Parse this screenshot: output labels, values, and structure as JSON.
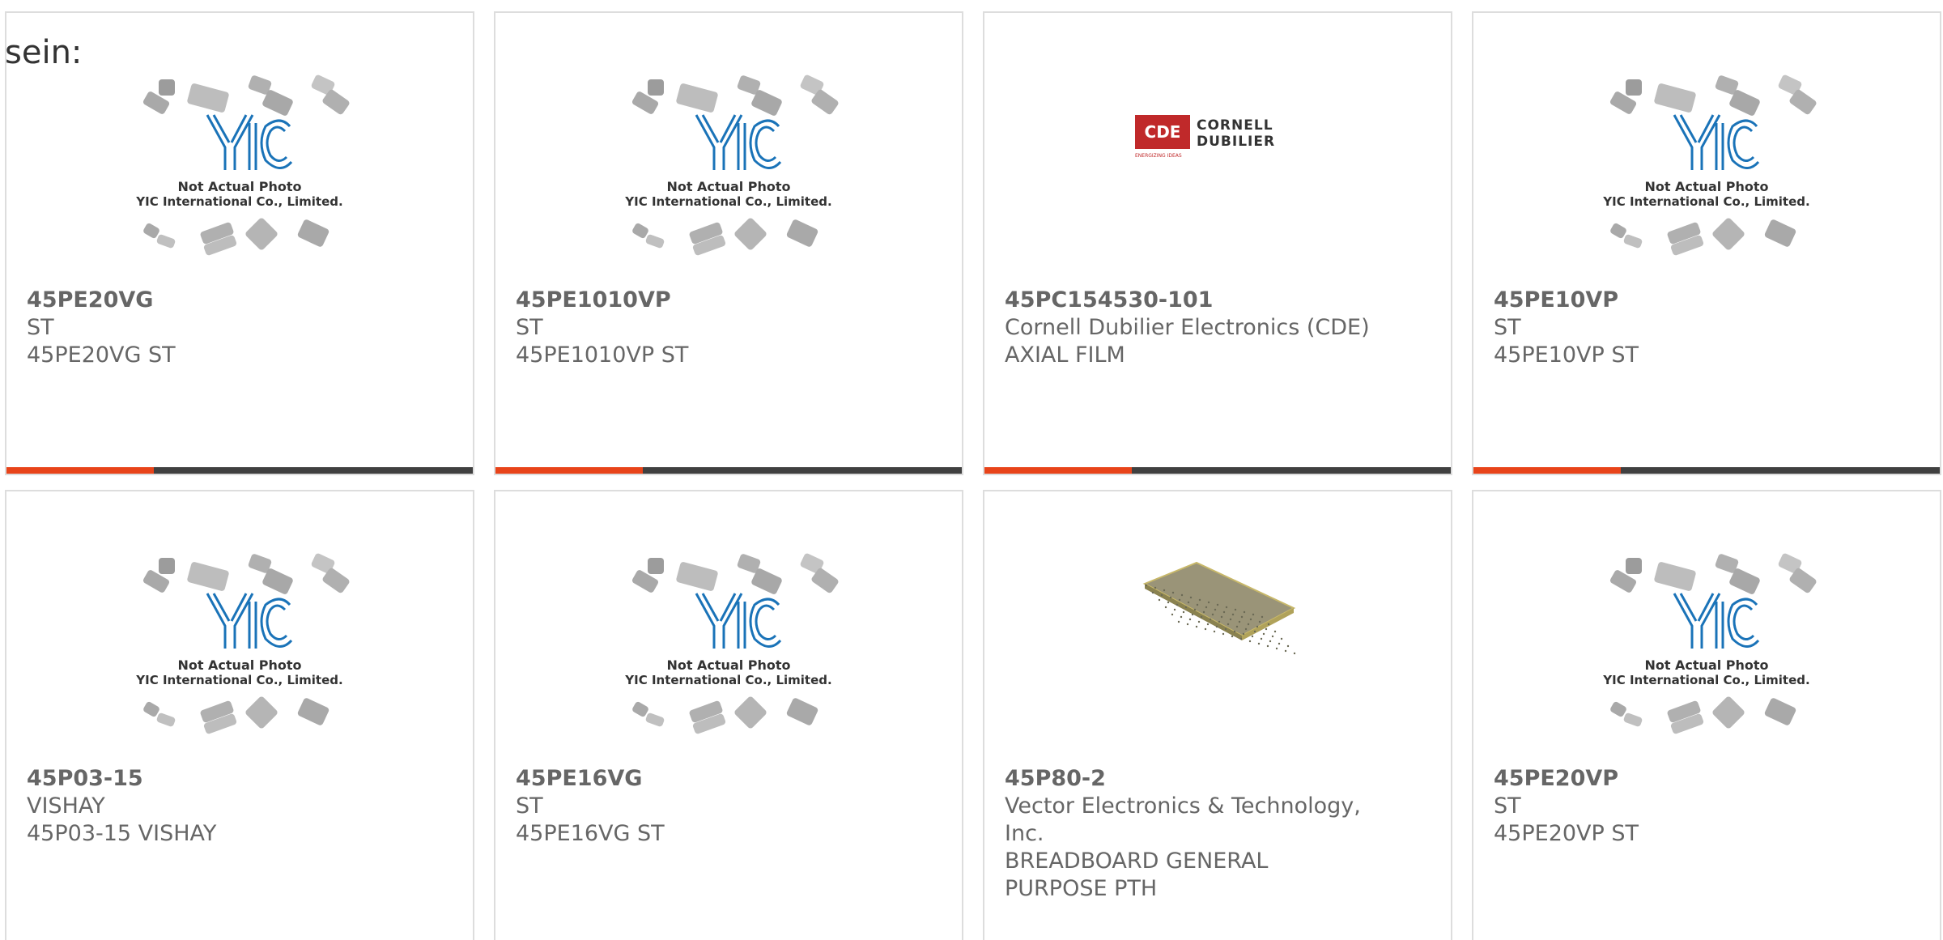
{
  "overlay": {
    "text": "sein:"
  },
  "placeholder_image": {
    "line1": "Not Actual Photo",
    "line2": "YIC International Co., Limited.",
    "logo_text": "YIC"
  },
  "cde_logo": {
    "badge": "CDE",
    "line1": "CORNELL",
    "line2": "DUBILIER",
    "tagline": "ENERGIZING IDEAS"
  },
  "colors": {
    "accent": "#e8441a",
    "bar": "#404040",
    "text": "#666666",
    "border": "#dddddd",
    "logo_blue": "#1a73b8"
  },
  "products": [
    {
      "title": "45PE20VG",
      "lines": [
        "ST",
        "45PE20VG ST"
      ],
      "image": "yic-placeholder"
    },
    {
      "title": "45PE1010VP",
      "lines": [
        "ST",
        "45PE1010VP ST"
      ],
      "image": "yic-placeholder"
    },
    {
      "title": "45PC154530-101",
      "lines": [
        "Cornell Dubilier Electronics (CDE)",
        "AXIAL FILM"
      ],
      "image": "cde-logo"
    },
    {
      "title": "45PE10VP",
      "lines": [
        "ST",
        "45PE10VP ST"
      ],
      "image": "yic-placeholder"
    },
    {
      "title": "45P03-15",
      "lines": [
        "VISHAY",
        "45P03-15 VISHAY"
      ],
      "image": "yic-placeholder"
    },
    {
      "title": "45PE16VG",
      "lines": [
        "ST",
        "45PE16VG ST"
      ],
      "image": "yic-placeholder"
    },
    {
      "title": "45P80-2",
      "lines": [
        "Vector Electronics & Technology,",
        "Inc.",
        "BREADBOARD GENERAL",
        "PURPOSE PTH"
      ],
      "image": "breadboard-photo"
    },
    {
      "title": "45PE20VP",
      "lines": [
        "ST",
        "45PE20VP ST"
      ],
      "image": "yic-placeholder"
    }
  ]
}
